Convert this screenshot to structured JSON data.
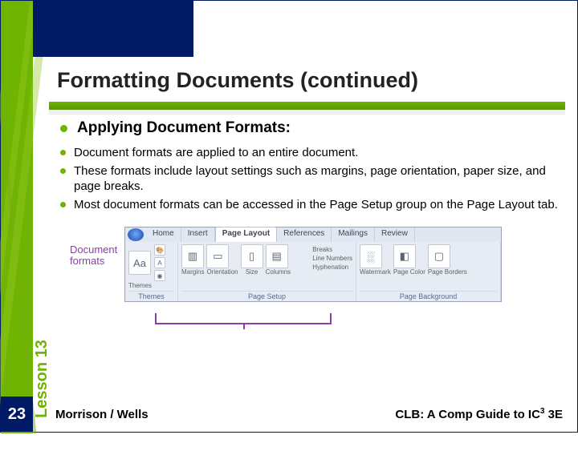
{
  "page_number": "23",
  "lesson_label": "Lesson 13",
  "title": "Formatting Documents (continued)",
  "heading": "Applying Document Formats:",
  "sub_bullets": [
    "Document formats are applied to an entire document.",
    "These formats include layout settings such as margins, page orientation, paper size, and page breaks.",
    "Most document formats can be accessed in the Page Setup group on the Page Layout tab."
  ],
  "ribbon": {
    "callout": "Document formats",
    "tabs": [
      "Home",
      "Insert",
      "Page Layout",
      "References",
      "Mailings",
      "Review"
    ],
    "active_tab_index": 2,
    "groups": {
      "themes": {
        "label": "Themes",
        "main_icon": "Aa",
        "sub_icons": [
          "🎨",
          "A",
          "◉"
        ],
        "btn": "Themes"
      },
      "page_setup": {
        "label": "Page Setup",
        "items": [
          "Margins",
          "Orientation",
          "Size",
          "Columns"
        ],
        "right": [
          "Breaks",
          "Line Numbers",
          "Hyphenation"
        ]
      },
      "page_background": {
        "label": "Page Background",
        "items": [
          "Watermark",
          "Page Color",
          "Page Borders"
        ]
      }
    }
  },
  "footer": {
    "left": "Morrison / Wells",
    "right_prefix": "CLB: A Comp Guide to IC",
    "right_sup": "3",
    "right_suffix": " 3E"
  }
}
